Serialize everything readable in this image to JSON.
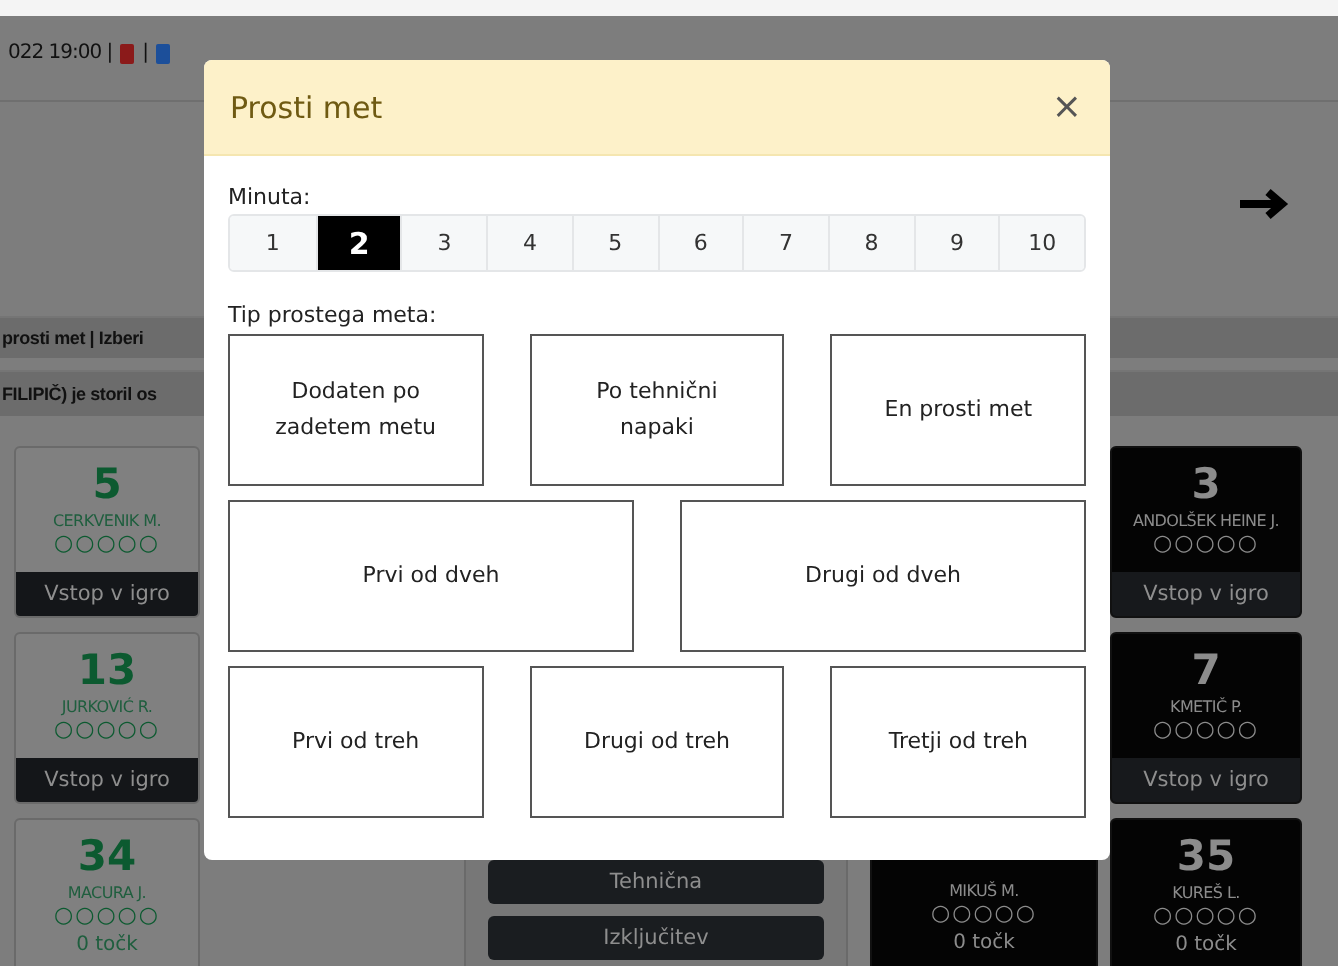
{
  "header": {
    "date": "022 19:00 |",
    "separator": "|"
  },
  "banners": [
    "prosti met | Izberi",
    "FILIPIČ) je storil os"
  ],
  "home_players": [
    {
      "number": "5",
      "name": "CERKVENIK M.",
      "fouls": "○○○○○",
      "action": "Vstop v igro"
    },
    {
      "number": "13",
      "name": "JURKOVIĆ R.",
      "fouls": "○○○○○",
      "action": "Vstop v igro"
    },
    {
      "number": "34",
      "name": "MACURA J.",
      "fouls": "○○○○○",
      "points": "0 točk"
    }
  ],
  "center": {
    "buttons": [
      "Tehnična",
      "Izključitev"
    ],
    "player": {
      "name": "MIKUŠ M.",
      "fouls": "○○○○○",
      "points": "0 točk"
    }
  },
  "away_players": [
    {
      "number": "3",
      "name": "ANDOLŠEK HEINE J.",
      "fouls": "○○○○○",
      "action": "Vstop v igro"
    },
    {
      "number": "7",
      "name": "KMETIČ P.",
      "fouls": "○○○○○",
      "action": "Vstop v igro"
    },
    {
      "number": "35",
      "name": "KUREŠ L.",
      "fouls": "○○○○○",
      "points": "0 točk"
    }
  ],
  "modal": {
    "title": "Prosti met",
    "close": "×",
    "minute_label": "Minuta:",
    "minutes": [
      {
        "label": "1",
        "selected": false
      },
      {
        "label": "2",
        "selected": true
      },
      {
        "label": "3",
        "selected": false
      },
      {
        "label": "4",
        "selected": false
      },
      {
        "label": "5",
        "selected": false
      },
      {
        "label": "6",
        "selected": false
      },
      {
        "label": "7",
        "selected": false
      },
      {
        "label": "8",
        "selected": false
      },
      {
        "label": "9",
        "selected": false
      },
      {
        "label": "10",
        "selected": false
      }
    ],
    "type_label": "Tip prostega meta:",
    "type_rows": [
      [
        "Dodaten po zadetem metu",
        "Po tehnični napaki",
        "En prosti met"
      ],
      [
        "Prvi od dveh",
        "Drugi od dveh"
      ],
      [
        "Prvi od treh",
        "Drugi od treh",
        "Tretji od treh"
      ]
    ]
  }
}
